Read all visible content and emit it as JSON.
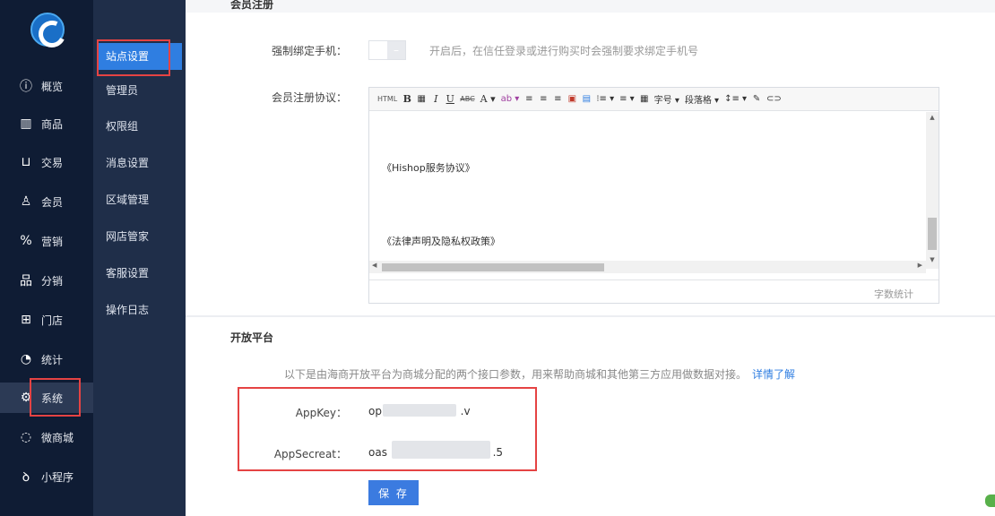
{
  "nav1": {
    "items": [
      {
        "label": "概览",
        "icon": "info-circle-icon",
        "glyph": "ⓘ"
      },
      {
        "label": "商品",
        "icon": "barcode-icon",
        "glyph": "▥"
      },
      {
        "label": "交易",
        "icon": "cart-icon",
        "glyph": "⊔"
      },
      {
        "label": "会员",
        "icon": "user-icon",
        "glyph": "♙"
      },
      {
        "label": "营销",
        "icon": "percent-tag-icon",
        "glyph": "%"
      },
      {
        "label": "分销",
        "icon": "hierarchy-icon",
        "glyph": "品"
      },
      {
        "label": "门店",
        "icon": "store-icon",
        "glyph": "⊞"
      },
      {
        "label": "统计",
        "icon": "pie-chart-icon",
        "glyph": "◔"
      },
      {
        "label": "系统",
        "icon": "gear-icon",
        "glyph": "⚙"
      },
      {
        "label": "微商城",
        "icon": "chat-icon",
        "glyph": "◌"
      },
      {
        "label": "小程序",
        "icon": "miniapp-icon",
        "glyph": "ꝺ"
      }
    ],
    "active": "系统"
  },
  "nav2": {
    "items": [
      "站点设置",
      "管理员",
      "权限组",
      "消息设置",
      "区域管理",
      "网店管家",
      "客服设置",
      "操作日志"
    ],
    "active": "站点设置"
  },
  "member_section": {
    "title_partial": "会员注册",
    "force_bind_label": "强制绑定手机：",
    "force_bind_hint": "开启后，在信任登录或进行购买时会强制要求绑定手机号",
    "switch_mark": "–",
    "agreement_label": "会员注册协议："
  },
  "editor": {
    "toolbar": [
      "HTML",
      "B",
      "▦",
      "I",
      "U",
      "ABC",
      "A ▾",
      "ab ▾",
      "≡",
      "≡",
      "≡",
      "▣",
      "▤",
      "⁝≡ ▾",
      "≡ ▾",
      "▦",
      "字号 ▾",
      "段落格 ▾",
      "↕≡ ▾",
      "✎",
      "⊂⊃"
    ],
    "paragraphs": [
      "《Hishop服务协议》",
      "《法律声明及隐私权政策》"
    ],
    "word_count_label": "字数统计"
  },
  "open_platform": {
    "title": "开放平台",
    "description": "以下是由海商开放平台为商城分配的两个接口参数，用来帮助商城和其他第三方应用做数据对接。",
    "details_link": "详情了解",
    "appkey_label": "AppKey：",
    "appkey_value_start": "op",
    "appkey_value_end": ".v",
    "appsecret_label": "AppSecreat：",
    "appsecret_value_start": "oas",
    "appsecret_value_end": ".5",
    "save_button": "保 存"
  },
  "colors": {
    "nav1_bg": "#0f1c34",
    "nav2_bg": "#1f2e49",
    "accent": "#2f7ee1",
    "highlight_red": "#e54343"
  }
}
